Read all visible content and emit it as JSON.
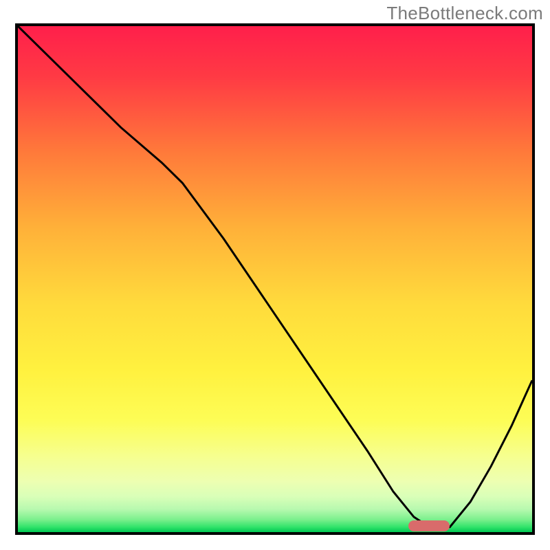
{
  "watermark": "TheBottleneck.com",
  "chart_data": {
    "type": "line",
    "title": "",
    "xlabel": "",
    "ylabel": "",
    "xlim": [
      0,
      100
    ],
    "ylim": [
      0,
      100
    ],
    "x": [
      0,
      6,
      12,
      20,
      28,
      32,
      40,
      48,
      56,
      62,
      68,
      73,
      77,
      80,
      84,
      88,
      92,
      96,
      100
    ],
    "values": [
      100,
      94,
      88,
      80,
      73,
      69,
      58,
      46,
      34,
      25,
      16,
      8,
      3,
      1,
      1,
      6,
      13,
      21,
      30
    ],
    "minimum_marker": {
      "x_start": 76,
      "x_end": 84,
      "y": 1
    },
    "background_gradient": {
      "stops": [
        {
          "pos": 0.0,
          "color": "#ff1f4b"
        },
        {
          "pos": 0.1,
          "color": "#ff3a44"
        },
        {
          "pos": 0.25,
          "color": "#ff7a3a"
        },
        {
          "pos": 0.4,
          "color": "#ffb139"
        },
        {
          "pos": 0.55,
          "color": "#ffdb3c"
        },
        {
          "pos": 0.68,
          "color": "#fff13f"
        },
        {
          "pos": 0.78,
          "color": "#fdfd56"
        },
        {
          "pos": 0.85,
          "color": "#f6ff8f"
        },
        {
          "pos": 0.9,
          "color": "#edffb2"
        },
        {
          "pos": 0.93,
          "color": "#d9ffb8"
        },
        {
          "pos": 0.955,
          "color": "#b7f9af"
        },
        {
          "pos": 0.975,
          "color": "#7cf08d"
        },
        {
          "pos": 0.99,
          "color": "#30e36a"
        },
        {
          "pos": 1.0,
          "color": "#00c853"
        }
      ]
    }
  }
}
